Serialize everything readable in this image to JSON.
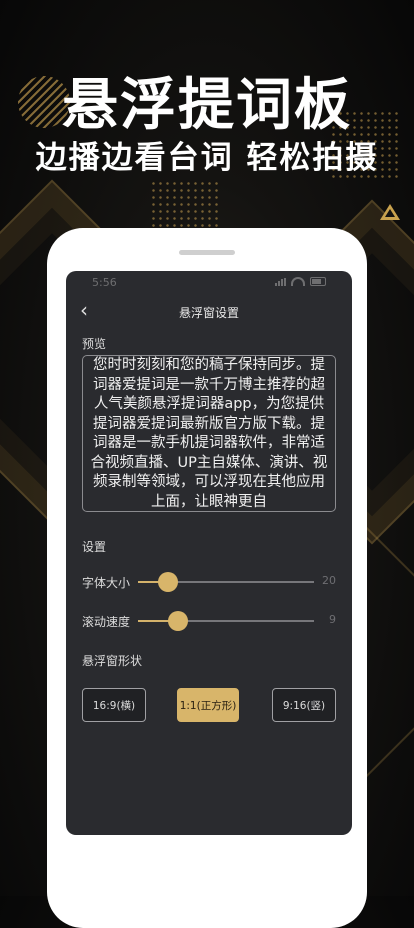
{
  "hero": {
    "title": "悬浮提词板",
    "subtitle": "边播边看台词 轻松拍摄"
  },
  "status_bar": {
    "time": "5:56"
  },
  "nav": {
    "back_icon": "‹",
    "title": "悬浮窗设置"
  },
  "preview": {
    "label": "预览",
    "text": "您时时刻刻和您的稿子保持同步。提词器爱提词是一款千万博主推荐的超人气美颜悬浮提词器app，为您提供提词器爱提词最新版官方版下载。提词器是一款手机提词器软件，非常适合视频直播、UP主自媒体、演讲、视频录制等领域，可以浮现在其他应用上面，让眼神更自"
  },
  "settings": {
    "label": "设置",
    "font_size": {
      "label": "字体大小",
      "value": "20",
      "level_fraction": 0.17
    },
    "scroll_speed": {
      "label": "滚动速度",
      "value": "9",
      "level_fraction": 0.23
    }
  },
  "shape": {
    "label": "悬浮窗形状",
    "options": [
      {
        "label": "16:9(横)",
        "selected": false
      },
      {
        "label": "1:1(正方形)",
        "selected": true
      },
      {
        "label": "9:16(竖)",
        "selected": false
      }
    ]
  },
  "colors": {
    "accent": "#d8b56a",
    "screen_bg": "#2a2b2f",
    "page_bg": "#0b0b0b"
  }
}
